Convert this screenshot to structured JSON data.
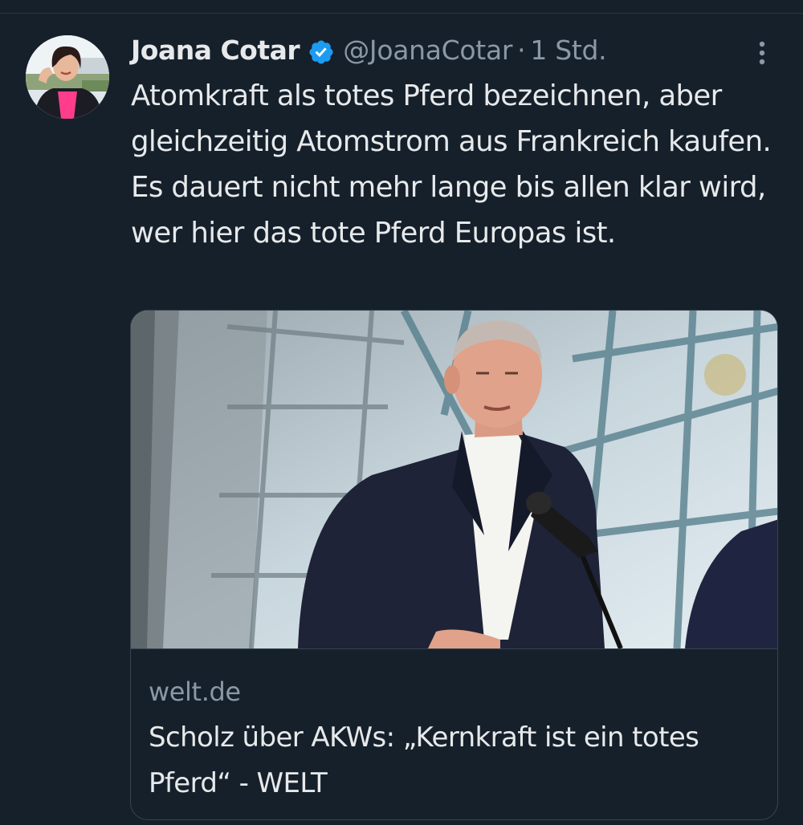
{
  "tweet": {
    "author": {
      "display_name": "Joana Cotar",
      "handle": "@JoanaCotar",
      "verified": true,
      "verified_icon": "verified-badge-icon",
      "verified_color": "#1d9bf0"
    },
    "separator": "·",
    "time": "1 Std.",
    "text": "Atomkraft als totes Pferd bezeichnen, aber gleichzeitig Atomstrom aus Frankreich kaufen. Es dauert nicht mehr lange bis allen klar wird, wer hier das tote Pferd Europas ist.",
    "more_icon": "more-vertical-icon",
    "link_card": {
      "domain": "welt.de",
      "title": "Scholz über AKWs: „Kernkraft ist ein totes Pferd“ - WELT"
    }
  },
  "colors": {
    "background": "#15202b",
    "text_primary": "#e7e9ea",
    "text_secondary": "#8b98a5",
    "border": "#38444d"
  }
}
